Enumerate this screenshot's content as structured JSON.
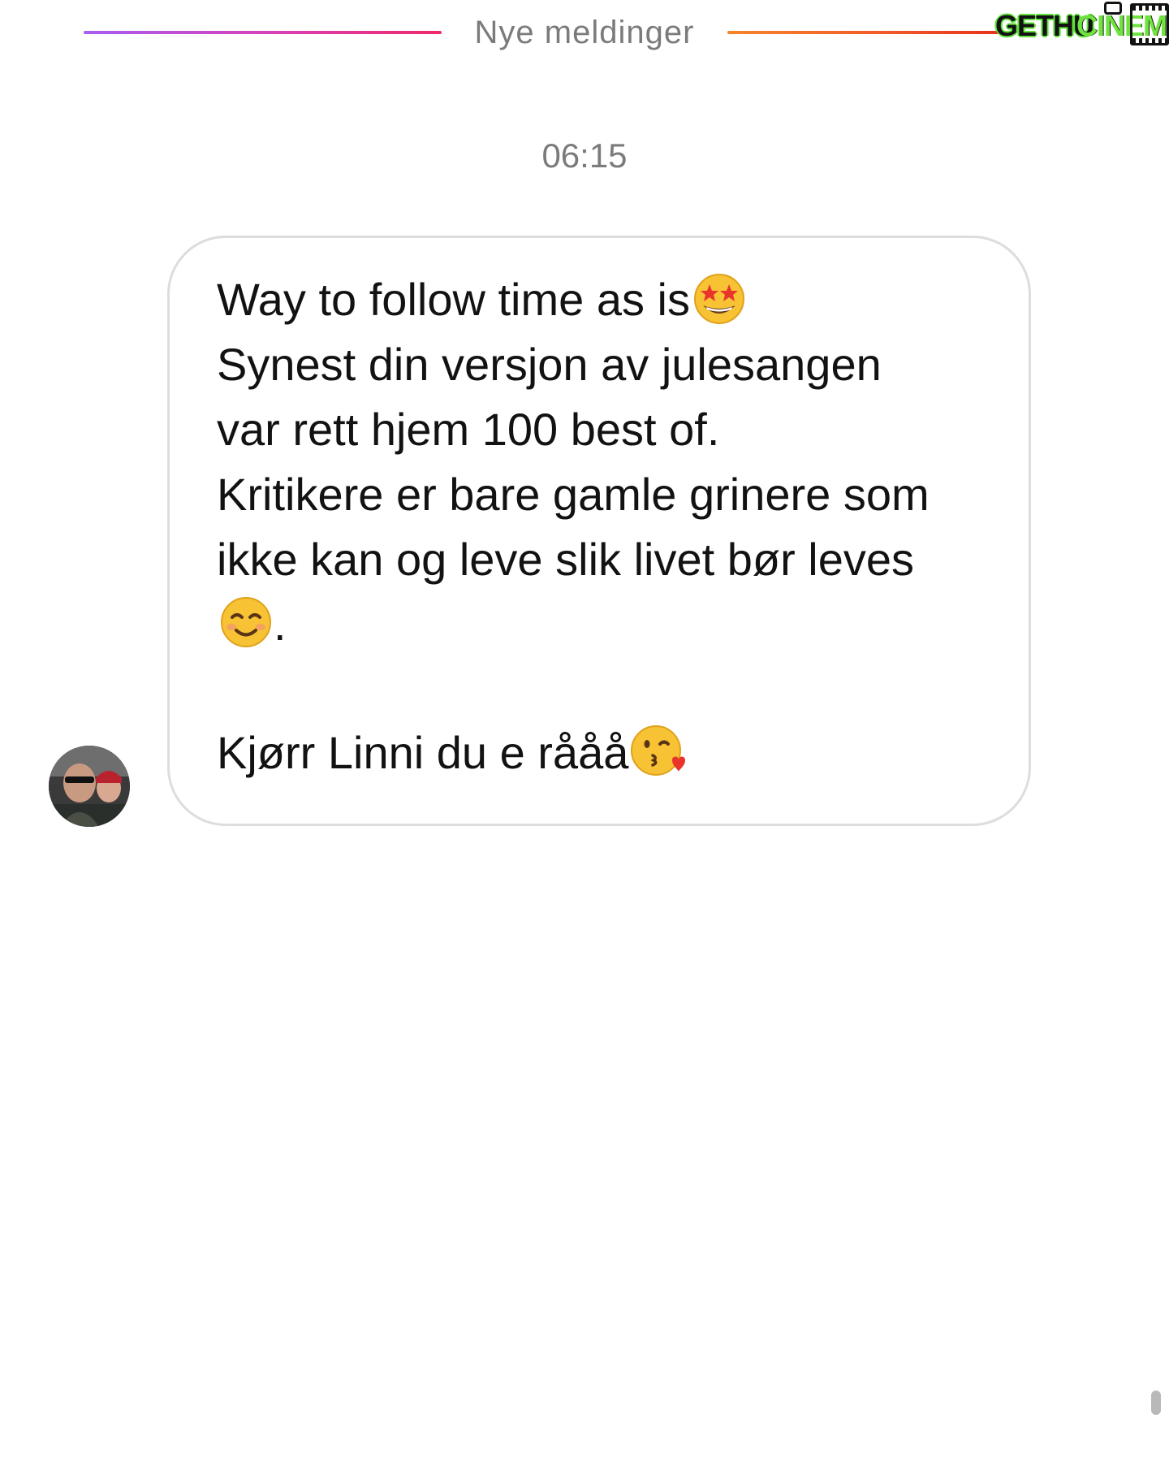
{
  "divider": {
    "label": "Nye meldinger"
  },
  "watermark": {
    "text_a": "GETHU",
    "text_b": "CINEMA"
  },
  "thread": {
    "timestamp": "06:15"
  },
  "message": {
    "line1": "Way to follow time as is",
    "line1_emoji": "star-struck-emoji",
    "line2": "Synest din versjon av julesangen",
    "line3": "var rett hjem 100 best of.",
    "line4": "Kritikere er bare gamle grinere som",
    "line5": "ikke kan og leve slik livet bør leves",
    "line6_emoji": "smiling-face-emoji",
    "line6_text": ".",
    "line7": "Kjørr Linni du e rååå",
    "line7_emoji": "face-blowing-kiss-emoji"
  },
  "colors": {
    "divider_left_start": "#a85df0",
    "divider_left_end": "#ef2a6a",
    "divider_right_start": "#f5862c",
    "divider_right_end": "#e8321c",
    "muted_text": "#7b7b7b",
    "bubble_border": "#dddddd"
  }
}
